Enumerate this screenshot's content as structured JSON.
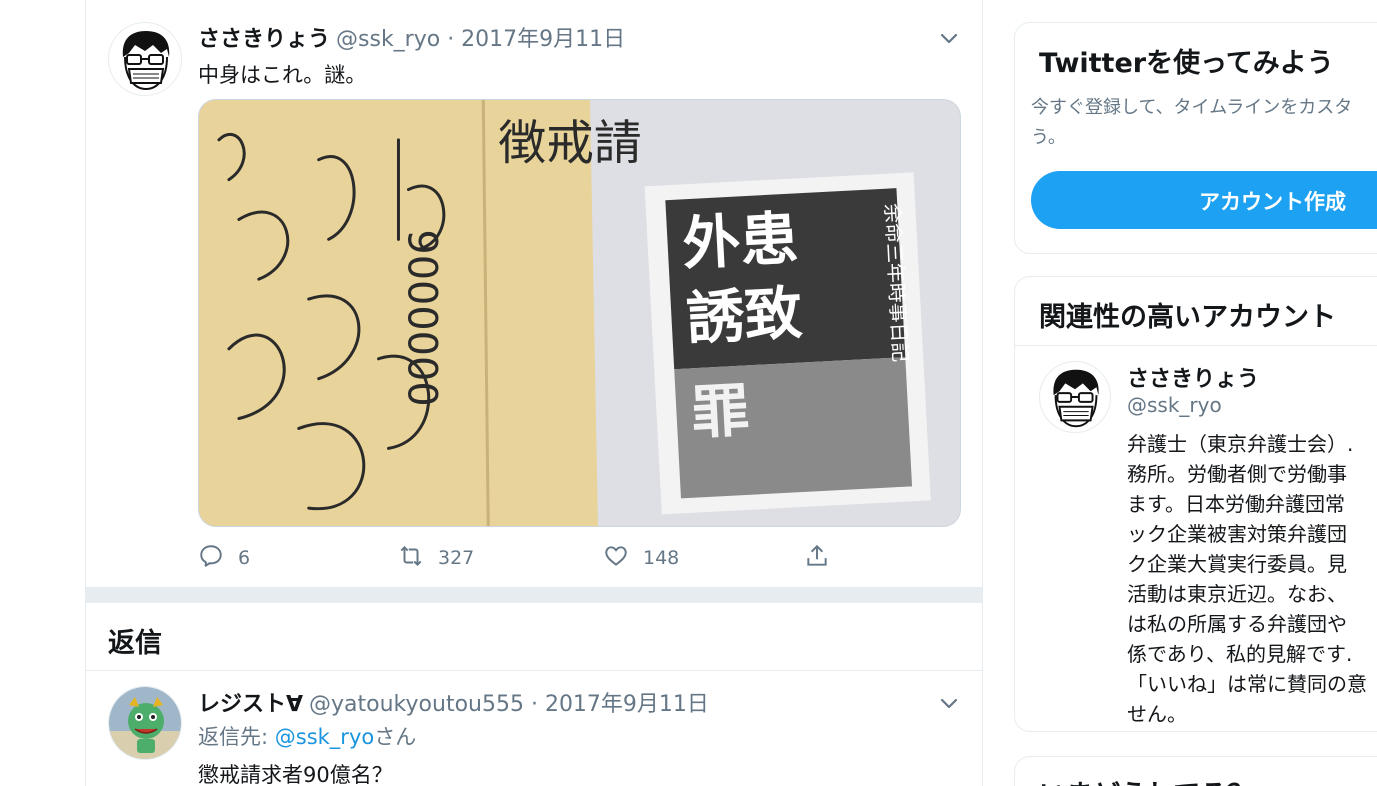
{
  "tweet": {
    "author_name": "ささきりょう",
    "author_meta": "@ssk_ryo · 2017年9月11日",
    "text": "中身はこれ。謎。",
    "media": {
      "envelope_strip1_text": "徴戒請",
      "envelope_strip2_text": "9000000",
      "book_title_line1": "外患",
      "book_title_line2": "誘致",
      "book_title_line3": "罪",
      "book_subtitle": "余命三年時事日記"
    },
    "actions": {
      "replies": "6",
      "retweets": "327",
      "likes": "148"
    }
  },
  "replies_section": {
    "title": "返信"
  },
  "reply": {
    "author_name": "レジスト∀",
    "author_meta": "@yatoukyoutou555 · 2017年9月11日",
    "reply_to_prefix": "返信先: ",
    "reply_to_handle": "@ssk_ryo",
    "reply_to_suffix": "さん",
    "text": "懲戒請求者90億名？"
  },
  "sidebar": {
    "signup_card": {
      "title": "Twitterを使ってみよう",
      "desc_line1": "今すぐ登録して、タイムラインをカスタ",
      "desc_line2": "う。",
      "button": "アカウント作成"
    },
    "related_card": {
      "title": "関連性の高いアカウント",
      "name": "ささきりょう",
      "handle": "@ssk_ryo",
      "bio_lines": [
        "弁護士（東京弁護士会）.",
        "務所。労働者側で労働事",
        "ます。日本労働弁護団常",
        "ック企業被害対策弁護団",
        "ク企業大賞実行委員。見",
        "活動は東京近辺。なお、",
        "は私の所属する弁護団や",
        "係であり、私的見解です.",
        "「いいね」は常に賛同の意",
        "せん。"
      ]
    },
    "trends_card": {
      "title": "いまどうしてる？"
    }
  },
  "colors": {
    "accent": "#1da1f2",
    "link": "#1b95e0",
    "secondary_text": "#657786",
    "border": "#e6ecf0"
  },
  "icons": [
    "chevron-down-icon",
    "reply-icon",
    "retweet-icon",
    "like-icon",
    "share-icon"
  ]
}
